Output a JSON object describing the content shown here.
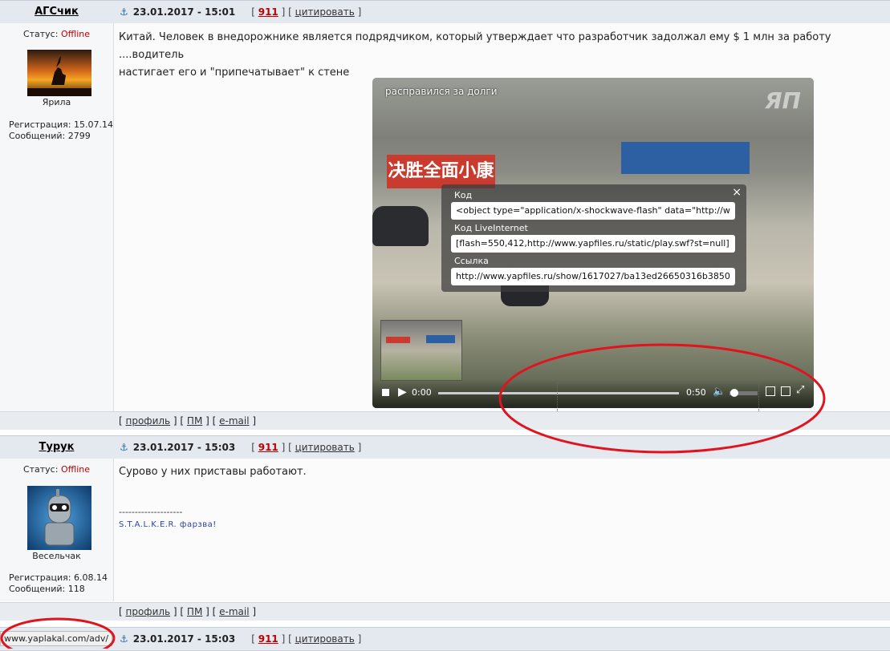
{
  "posts": [
    {
      "author": "АГСчик",
      "date": "23.01.2017 - 15:01",
      "post_number": "911",
      "cite_label": "цитировать",
      "status_label": "Статус:",
      "status_value": "Offline",
      "rank": "Ярила",
      "registration": "Регистрация: 15.07.14",
      "messages": "Сообщений: 2799",
      "text_line1": "Китай. Человек в внедорожнике является подрядчиком, который утверждает что разработчик задолжал ему $ 1 млн за работу ....водитель",
      "text_line2": "настигает его и \"припечатывает\" к стене",
      "footer": {
        "profile": "профиль",
        "pm": "ПМ",
        "email": "e-mail"
      }
    },
    {
      "author": "Турук",
      "date": "23.01.2017 - 15:03",
      "post_number": "911",
      "cite_label": "цитировать",
      "status_label": "Статус:",
      "status_value": "Offline",
      "rank": "Весельчак",
      "registration": "Регистрация: 6.08.14",
      "messages": "Сообщений: 118",
      "text_line1": "Сурово у них приставы работают.",
      "signature_sep": "--------------------",
      "signature": "S.T.A.L.K.E.R. фарзва!",
      "footer": {
        "profile": "профиль",
        "pm": "ПМ",
        "email": "e-mail"
      }
    },
    {
      "date": "23.01.2017 - 15:03",
      "post_number": "911",
      "cite_label": "цитировать"
    }
  ],
  "video": {
    "title": "расправился за долги",
    "logo": "ЯП",
    "time_current": "0:00",
    "time_total": "0:50",
    "progress": 0,
    "volume": 0.1,
    "popup": {
      "label_code": "Код",
      "value_code": "<object type=\"application/x-shockwave-flash\" data=\"http://w",
      "label_li": "Код LiveInternet",
      "value_li": "[flash=550,412,http://www.yapfiles.ru/static/play.swf?st=null]",
      "label_link": "Ссылка",
      "value_link": "http://www.yapfiles.ru/show/1617027/ba13ed26650316b3850",
      "close": "×"
    }
  },
  "status_bar_url": "www.yaplakal.com/adv/",
  "colors": {
    "offline": "#c00000",
    "post_number": "#c00000",
    "annotation": "#e0141e"
  }
}
